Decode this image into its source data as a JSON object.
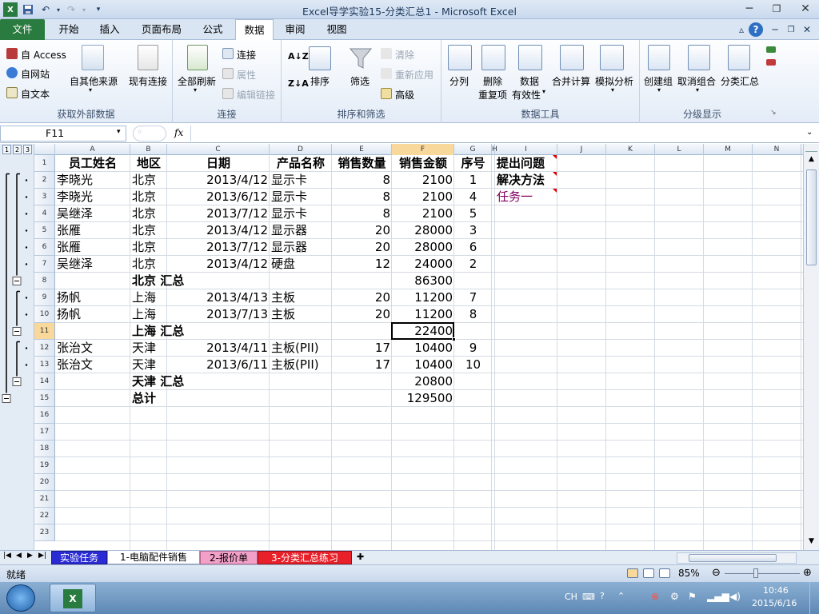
{
  "window": {
    "title": "Excel导学实验15-分类汇总1 - Microsoft Excel",
    "qat_icons": [
      "excel-app-icon",
      "save-icon",
      "undo-icon",
      "redo-icon",
      "customize-qat-icon"
    ],
    "controls": [
      "minimize-icon",
      "restore-icon",
      "close-icon"
    ]
  },
  "tabs": [
    {
      "label": "文件"
    },
    {
      "label": "开始"
    },
    {
      "label": "插入"
    },
    {
      "label": "页面布局"
    },
    {
      "label": "公式"
    },
    {
      "label": "数据"
    },
    {
      "label": "审阅"
    },
    {
      "label": "视图"
    }
  ],
  "active_tab": "数据",
  "ribbon": {
    "external": {
      "label": "获取外部数据",
      "access": "自 Access",
      "web": "自网站",
      "text": "自文本",
      "other": "自其他来源",
      "existing": "现有连接"
    },
    "connections": {
      "label": "连接",
      "refresh": "全部刷新",
      "conn": "连接",
      "props": "属性",
      "edit": "编辑链接"
    },
    "sort": {
      "label": "排序和筛选",
      "sort": "排序",
      "filter": "筛选",
      "clear": "清除",
      "reapply": "重新应用",
      "advanced": "高级"
    },
    "tools": {
      "label": "数据工具",
      "split": "分列",
      "dedup1": "删除",
      "dedup2": "重复项",
      "valid1": "数据",
      "valid2": "有效性",
      "consolidate": "合并计算",
      "whatif": "模拟分析"
    },
    "outline": {
      "label": "分级显示",
      "group": "创建组",
      "ungroup": "取消组合",
      "subtotal": "分类汇总"
    }
  },
  "formula_bar": {
    "name_box": "F11",
    "fx": "fx",
    "formula": ""
  },
  "columns": [
    "A",
    "B",
    "C",
    "D",
    "E",
    "F",
    "G",
    "H",
    "I",
    "J",
    "K",
    "L",
    "M",
    "N"
  ],
  "outline_levels": [
    "1",
    "2",
    "3"
  ],
  "rows": [
    {
      "n": "1",
      "A": "员工姓名",
      "B": "地区",
      "C": "日期",
      "D": "产品名称",
      "E": "销售数量",
      "F": "销售金额",
      "G": "序号",
      "I": "提出问题"
    },
    {
      "n": "2",
      "A": "李晓光",
      "B": "北京",
      "C": "2013/4/12",
      "D": "显示卡",
      "E": "8",
      "F": "2100",
      "G": "1",
      "I": "解决方法"
    },
    {
      "n": "3",
      "A": "李晓光",
      "B": "北京",
      "C": "2013/6/12",
      "D": "显示卡",
      "E": "8",
      "F": "2100",
      "G": "4",
      "I": "任务一"
    },
    {
      "n": "4",
      "A": "吴继泽",
      "B": "北京",
      "C": "2013/7/12",
      "D": "显示卡",
      "E": "8",
      "F": "2100",
      "G": "5"
    },
    {
      "n": "5",
      "A": "张雁",
      "B": "北京",
      "C": "2013/4/12",
      "D": "显示器",
      "E": "20",
      "F": "28000",
      "G": "3"
    },
    {
      "n": "6",
      "A": "张雁",
      "B": "北京",
      "C": "2013/7/12",
      "D": "显示器",
      "E": "20",
      "F": "28000",
      "G": "6"
    },
    {
      "n": "7",
      "A": "吴继泽",
      "B": "北京",
      "C": "2013/4/12",
      "D": "硬盘",
      "E": "12",
      "F": "24000",
      "G": "2"
    },
    {
      "n": "8",
      "B": "北京 汇总",
      "F": "86300"
    },
    {
      "n": "9",
      "A": "扬帆",
      "B": "上海",
      "C": "2013/4/13",
      "D": "主板",
      "E": "20",
      "F": "11200",
      "G": "7"
    },
    {
      "n": "10",
      "A": "扬帆",
      "B": "上海",
      "C": "2013/7/13",
      "D": "主板",
      "E": "20",
      "F": "11200",
      "G": "8"
    },
    {
      "n": "11",
      "B": "上海 汇总",
      "F": "22400"
    },
    {
      "n": "12",
      "A": "张治文",
      "B": "天津",
      "C": "2013/4/11",
      "D": "主板(PII)",
      "E": "17",
      "F": "10400",
      "G": "9"
    },
    {
      "n": "13",
      "A": "张治文",
      "B": "天津",
      "C": "2013/6/11",
      "D": "主板(PII)",
      "E": "17",
      "F": "10400",
      "G": "10"
    },
    {
      "n": "14",
      "B": "天津 汇总",
      "F": "20800"
    },
    {
      "n": "15",
      "B": "总计",
      "F": "129500"
    },
    {
      "n": "16"
    },
    {
      "n": "17"
    },
    {
      "n": "18"
    },
    {
      "n": "19"
    },
    {
      "n": "20"
    },
    {
      "n": "21"
    },
    {
      "n": "22"
    },
    {
      "n": "23"
    }
  ],
  "selected_cell": {
    "col": "F",
    "row": "11"
  },
  "sheet_tabs": [
    {
      "label": "实验任务",
      "color": "#2b2bd6"
    },
    {
      "label": "1-电脑配件销售",
      "color": "#ffffff"
    },
    {
      "label": "2-报价单",
      "color": "#f2a0c8"
    },
    {
      "label": "3-分类汇总练习",
      "color": "#e8202a"
    }
  ],
  "status": {
    "ready": "就绪",
    "zoom": "85%"
  },
  "taskbar": {
    "lang": "CH",
    "time": "10:46",
    "date": "2015/6/16"
  },
  "colors": {
    "file_tab": "#2a7b3f",
    "selection_header": "#f9d99b",
    "purple_text": "#800060"
  }
}
